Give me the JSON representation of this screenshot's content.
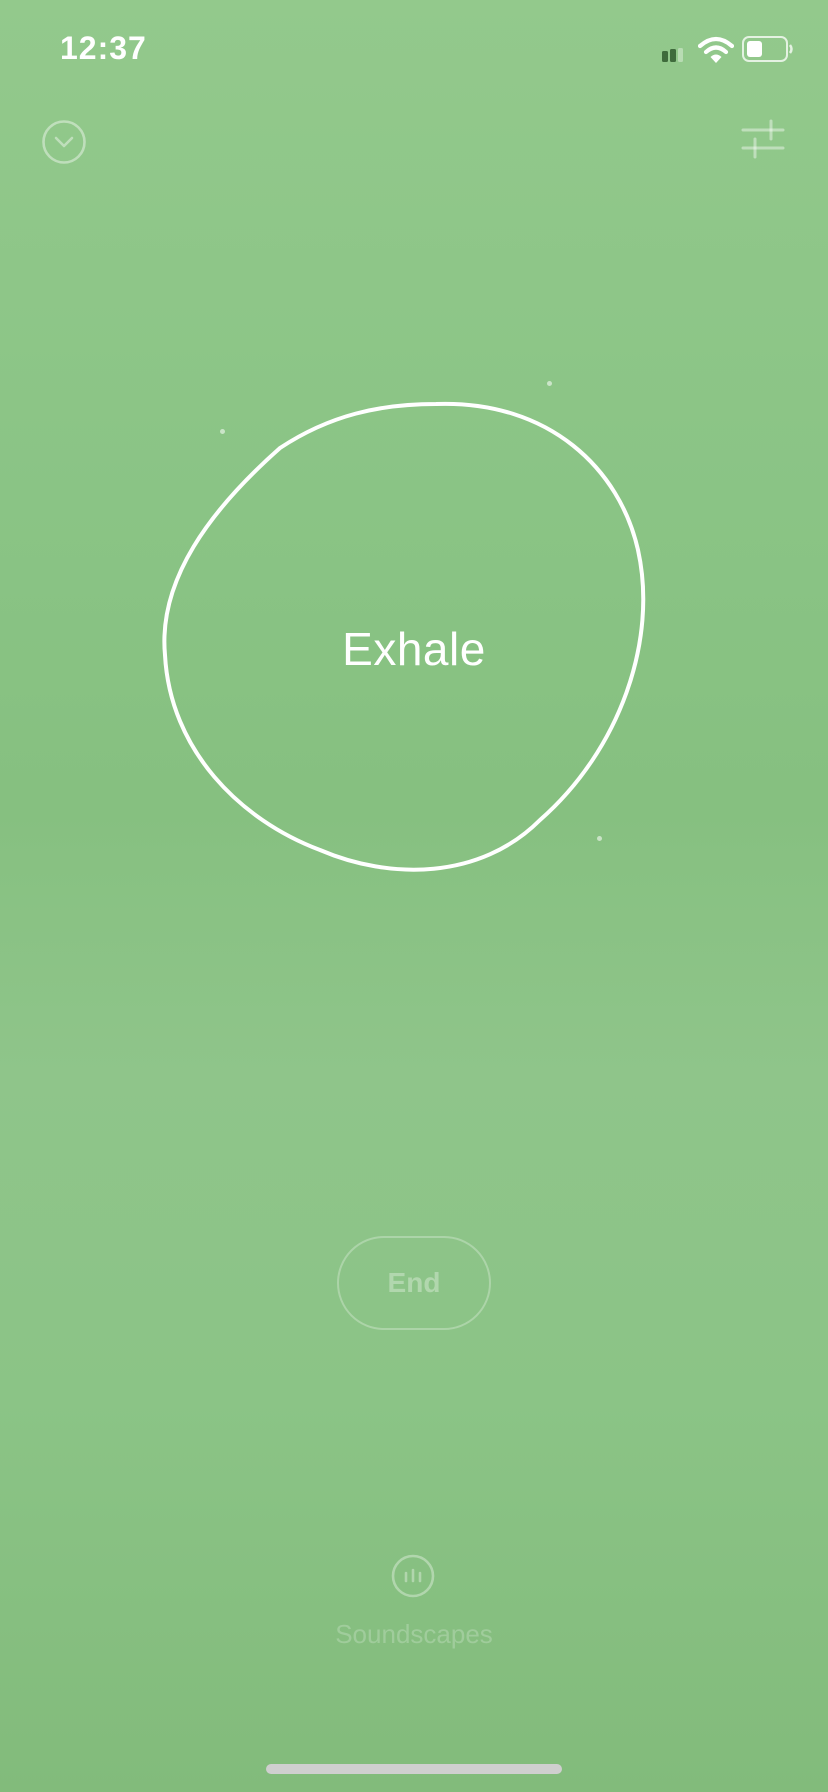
{
  "status_bar": {
    "time": "12:37",
    "icons": [
      "signal-icon",
      "wifi-icon",
      "battery-icon"
    ]
  },
  "header": {
    "left_icon": "chevron-down-circle-icon",
    "right_icon": "sliders-icon"
  },
  "breath": {
    "label": "Exhale"
  },
  "controls": {
    "end_label": "End"
  },
  "footer": {
    "soundscapes_icon": "soundscapes-icon",
    "soundscapes_label": "Soundscapes"
  },
  "colors": {
    "background": "#8ac485",
    "text": "#ffffff",
    "home_indicator": "#cfcfcf"
  }
}
